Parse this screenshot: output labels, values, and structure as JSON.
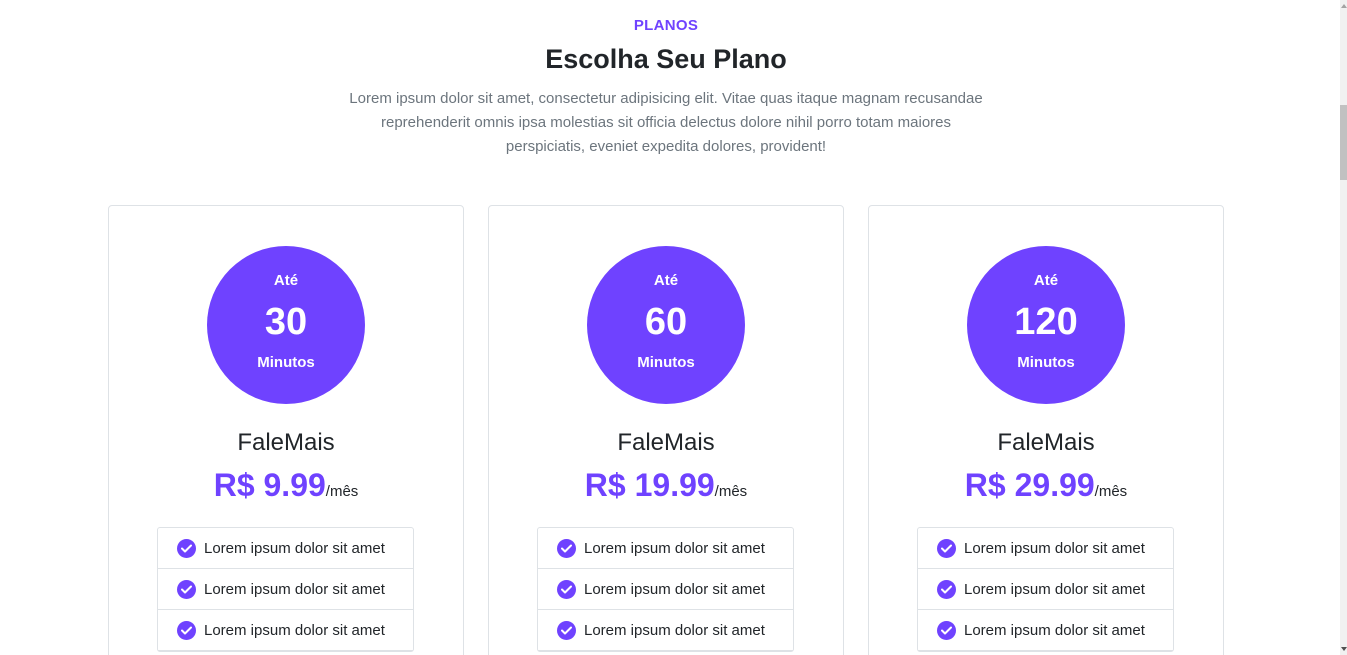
{
  "header": {
    "eyebrow": "PLANOS",
    "title": "Escolha Seu Plano",
    "subtitle": "Lorem ipsum dolor sit amet, consectetur adipisicing elit. Vitae quas itaque magnam recusandae reprehenderit omnis ipsa molestias sit officia delectus dolore nihil porro totam maiores perspiciatis, eveniet expedita dolores, provident!"
  },
  "colors": {
    "accent": "#6f42ff",
    "text": "#212529",
    "muted": "#6c757d",
    "border": "#dee2e6"
  },
  "plans": [
    {
      "circle_top": "Até",
      "minutes": "30",
      "circle_bottom": "Minutos",
      "name": "FaleMais",
      "price": "R$ 9.99",
      "period": "/mês",
      "features": [
        "Lorem ipsum dolor sit amet",
        "Lorem ipsum dolor sit amet",
        "Lorem ipsum dolor sit amet"
      ]
    },
    {
      "circle_top": "Até",
      "minutes": "60",
      "circle_bottom": "Minutos",
      "name": "FaleMais",
      "price": "R$ 19.99",
      "period": "/mês",
      "features": [
        "Lorem ipsum dolor sit amet",
        "Lorem ipsum dolor sit amet",
        "Lorem ipsum dolor sit amet"
      ]
    },
    {
      "circle_top": "Até",
      "minutes": "120",
      "circle_bottom": "Minutos",
      "name": "FaleMais",
      "price": "R$ 29.99",
      "period": "/mês",
      "features": [
        "Lorem ipsum dolor sit amet",
        "Lorem ipsum dolor sit amet",
        "Lorem ipsum dolor sit amet"
      ]
    }
  ],
  "icons": {
    "feature_icon": "check-circle-icon"
  }
}
